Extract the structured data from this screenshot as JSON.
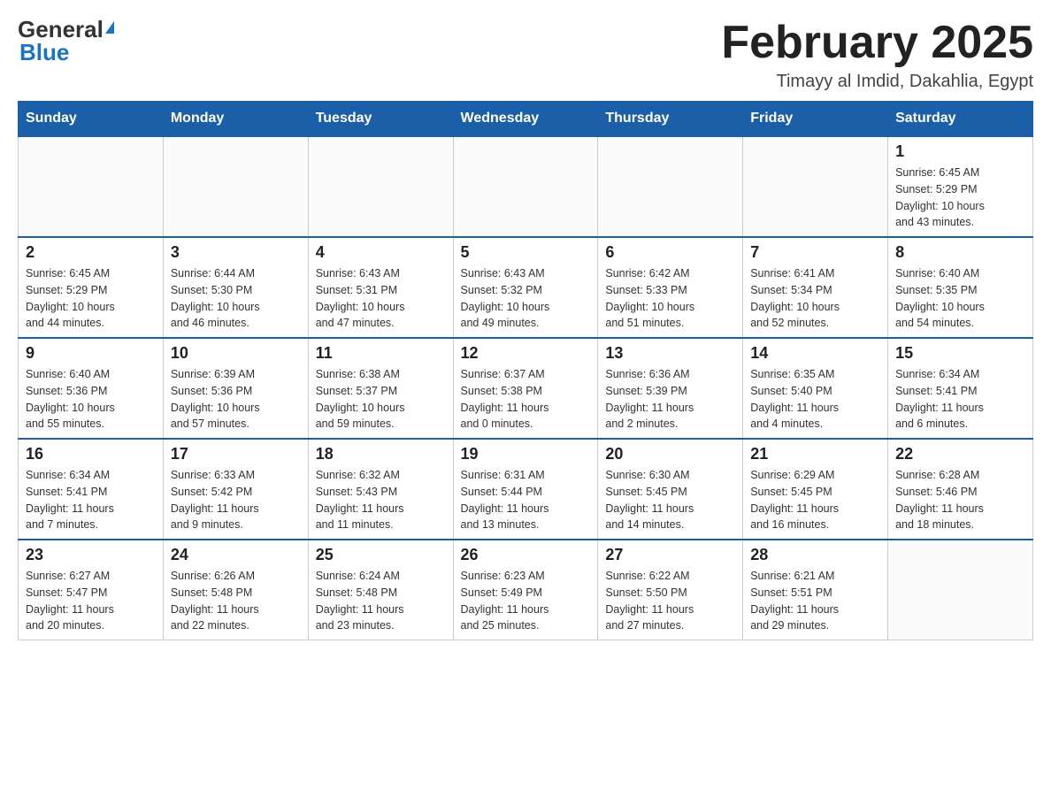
{
  "header": {
    "logo_general": "General",
    "logo_blue": "Blue",
    "month_title": "February 2025",
    "location": "Timayy al Imdid, Dakahlia, Egypt"
  },
  "days_of_week": [
    "Sunday",
    "Monday",
    "Tuesday",
    "Wednesday",
    "Thursday",
    "Friday",
    "Saturday"
  ],
  "weeks": [
    {
      "days": [
        {
          "number": "",
          "info": ""
        },
        {
          "number": "",
          "info": ""
        },
        {
          "number": "",
          "info": ""
        },
        {
          "number": "",
          "info": ""
        },
        {
          "number": "",
          "info": ""
        },
        {
          "number": "",
          "info": ""
        },
        {
          "number": "1",
          "info": "Sunrise: 6:45 AM\nSunset: 5:29 PM\nDaylight: 10 hours\nand 43 minutes."
        }
      ]
    },
    {
      "days": [
        {
          "number": "2",
          "info": "Sunrise: 6:45 AM\nSunset: 5:29 PM\nDaylight: 10 hours\nand 44 minutes."
        },
        {
          "number": "3",
          "info": "Sunrise: 6:44 AM\nSunset: 5:30 PM\nDaylight: 10 hours\nand 46 minutes."
        },
        {
          "number": "4",
          "info": "Sunrise: 6:43 AM\nSunset: 5:31 PM\nDaylight: 10 hours\nand 47 minutes."
        },
        {
          "number": "5",
          "info": "Sunrise: 6:43 AM\nSunset: 5:32 PM\nDaylight: 10 hours\nand 49 minutes."
        },
        {
          "number": "6",
          "info": "Sunrise: 6:42 AM\nSunset: 5:33 PM\nDaylight: 10 hours\nand 51 minutes."
        },
        {
          "number": "7",
          "info": "Sunrise: 6:41 AM\nSunset: 5:34 PM\nDaylight: 10 hours\nand 52 minutes."
        },
        {
          "number": "8",
          "info": "Sunrise: 6:40 AM\nSunset: 5:35 PM\nDaylight: 10 hours\nand 54 minutes."
        }
      ]
    },
    {
      "days": [
        {
          "number": "9",
          "info": "Sunrise: 6:40 AM\nSunset: 5:36 PM\nDaylight: 10 hours\nand 55 minutes."
        },
        {
          "number": "10",
          "info": "Sunrise: 6:39 AM\nSunset: 5:36 PM\nDaylight: 10 hours\nand 57 minutes."
        },
        {
          "number": "11",
          "info": "Sunrise: 6:38 AM\nSunset: 5:37 PM\nDaylight: 10 hours\nand 59 minutes."
        },
        {
          "number": "12",
          "info": "Sunrise: 6:37 AM\nSunset: 5:38 PM\nDaylight: 11 hours\nand 0 minutes."
        },
        {
          "number": "13",
          "info": "Sunrise: 6:36 AM\nSunset: 5:39 PM\nDaylight: 11 hours\nand 2 minutes."
        },
        {
          "number": "14",
          "info": "Sunrise: 6:35 AM\nSunset: 5:40 PM\nDaylight: 11 hours\nand 4 minutes."
        },
        {
          "number": "15",
          "info": "Sunrise: 6:34 AM\nSunset: 5:41 PM\nDaylight: 11 hours\nand 6 minutes."
        }
      ]
    },
    {
      "days": [
        {
          "number": "16",
          "info": "Sunrise: 6:34 AM\nSunset: 5:41 PM\nDaylight: 11 hours\nand 7 minutes."
        },
        {
          "number": "17",
          "info": "Sunrise: 6:33 AM\nSunset: 5:42 PM\nDaylight: 11 hours\nand 9 minutes."
        },
        {
          "number": "18",
          "info": "Sunrise: 6:32 AM\nSunset: 5:43 PM\nDaylight: 11 hours\nand 11 minutes."
        },
        {
          "number": "19",
          "info": "Sunrise: 6:31 AM\nSunset: 5:44 PM\nDaylight: 11 hours\nand 13 minutes."
        },
        {
          "number": "20",
          "info": "Sunrise: 6:30 AM\nSunset: 5:45 PM\nDaylight: 11 hours\nand 14 minutes."
        },
        {
          "number": "21",
          "info": "Sunrise: 6:29 AM\nSunset: 5:45 PM\nDaylight: 11 hours\nand 16 minutes."
        },
        {
          "number": "22",
          "info": "Sunrise: 6:28 AM\nSunset: 5:46 PM\nDaylight: 11 hours\nand 18 minutes."
        }
      ]
    },
    {
      "days": [
        {
          "number": "23",
          "info": "Sunrise: 6:27 AM\nSunset: 5:47 PM\nDaylight: 11 hours\nand 20 minutes."
        },
        {
          "number": "24",
          "info": "Sunrise: 6:26 AM\nSunset: 5:48 PM\nDaylight: 11 hours\nand 22 minutes."
        },
        {
          "number": "25",
          "info": "Sunrise: 6:24 AM\nSunset: 5:48 PM\nDaylight: 11 hours\nand 23 minutes."
        },
        {
          "number": "26",
          "info": "Sunrise: 6:23 AM\nSunset: 5:49 PM\nDaylight: 11 hours\nand 25 minutes."
        },
        {
          "number": "27",
          "info": "Sunrise: 6:22 AM\nSunset: 5:50 PM\nDaylight: 11 hours\nand 27 minutes."
        },
        {
          "number": "28",
          "info": "Sunrise: 6:21 AM\nSunset: 5:51 PM\nDaylight: 11 hours\nand 29 minutes."
        },
        {
          "number": "",
          "info": ""
        }
      ]
    }
  ]
}
